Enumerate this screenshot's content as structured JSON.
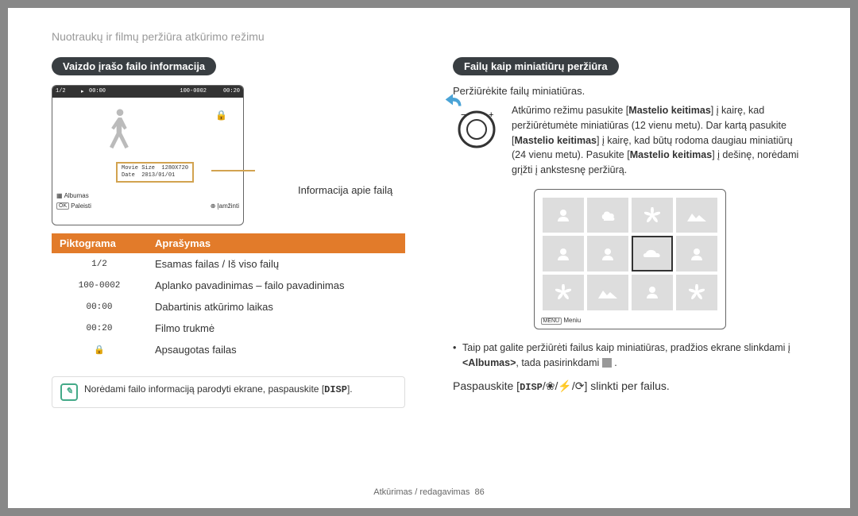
{
  "breadcrumb": "Nuotraukų ir filmų peržiūra atkūrimo režimu",
  "left": {
    "pill": "Vaizdo įrašo failo informacija",
    "screen1": {
      "counter": "1/2",
      "time_l": "00:00",
      "folder": "100-0002",
      "time_r": "00:20",
      "info": {
        "l1": "Movie Size",
        "v1": "1280X720",
        "l2": "Date",
        "v2": "2013/01/01"
      },
      "album": "Albumas",
      "ok": "OK",
      "play": "Paleisti",
      "zoom": "Įamžinti"
    },
    "caption": "Informacija apie failą",
    "table": {
      "h1": "Piktograma",
      "h2": "Aprašymas",
      "rows": [
        {
          "p": "1/2",
          "d": "Esamas failas / Iš viso failų"
        },
        {
          "p": "100-0002",
          "d": "Aplanko pavadinimas – failo pavadinimas"
        },
        {
          "p": "00:00",
          "d": "Dabartinis atkūrimo laikas"
        },
        {
          "p": "00:20",
          "d": "Filmo trukmė"
        },
        {
          "p": "🔒",
          "d": "Apsaugotas failas"
        }
      ]
    },
    "note": {
      "pre": "Norėdami failo informaciją parodyti ekrane, paspauskite [",
      "btn": "DISP",
      "post": "]."
    }
  },
  "right": {
    "pill": "Failų kaip miniatiūrų peržiūra",
    "intro": "Peržiūrėkite failų miniatiūras.",
    "dial": {
      "p1": "Atkūrimo režimu pasukite [",
      "b1": "Mastelio keitimas",
      "p2": "] į kairę, kad peržiūrėtumėte miniatiūras (12 vienu metu). Dar kartą pasukite [",
      "b2": "Mastelio keitimas",
      "p3": "] į kairę, kad būtų rodoma daugiau miniatiūrų (24 vienu metu). Pasukite [",
      "b3": "Mastelio keitimas",
      "p4": "] į dešinę, norėdami grįžti į ankstesnę peržiūrą."
    },
    "menu": "Meniu",
    "menuBtn": "MENU",
    "bullet": {
      "p1": "Taip pat galite peržiūrėti failus kaip miniatiūras, pradžios ekrane slinkdami į ",
      "b": "<Albumas>",
      "p2": ", tada pasirinkdami "
    },
    "action": {
      "p1": "Paspauskite [",
      "btn": "DISP",
      "mid": "/",
      "rest": "] slinkti per failus."
    }
  },
  "footer": {
    "section": "Atkūrimas / redagavimas",
    "page": "86"
  }
}
